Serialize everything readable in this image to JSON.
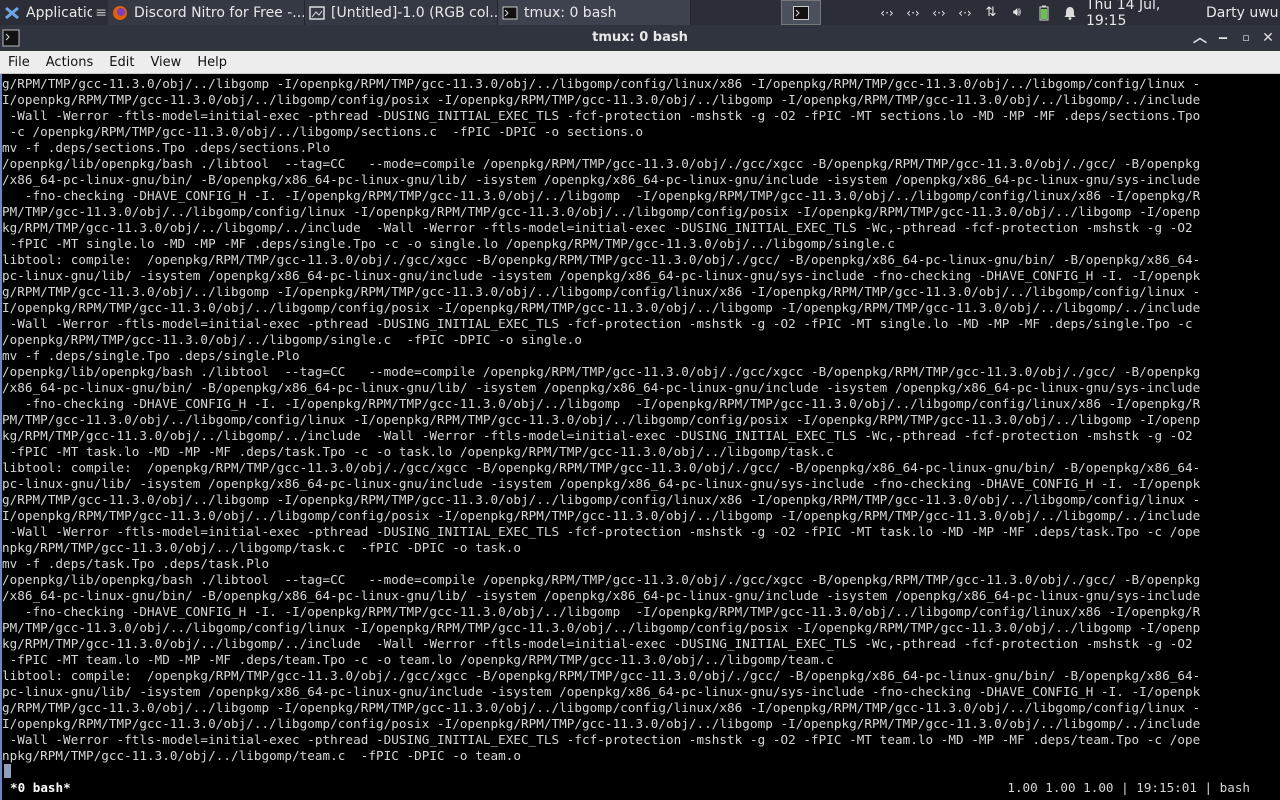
{
  "panel": {
    "apps_label": "Applications",
    "tasks": [
      {
        "label": "Discord Nitro for Free -..."
      },
      {
        "label": "[Untitled]-1.0 (RGB col..."
      },
      {
        "label": "tmux: 0 bash"
      }
    ],
    "clock": "Thu 14 Jul, 19:15",
    "user": "Darty uwu",
    "tray_icons": [
      "network-icon",
      "network-icon",
      "network-icon",
      "network-icon",
      "transfer-icon",
      "volume-icon",
      "battery-icon",
      "bell-icon"
    ]
  },
  "window": {
    "title": "tmux: 0 bash",
    "menu": [
      "File",
      "Actions",
      "Edit",
      "View",
      "Help"
    ]
  },
  "terminal": {
    "lines": [
      "g/RPM/TMP/gcc-11.3.0/obj/../libgomp -I/openpkg/RPM/TMP/gcc-11.3.0/obj/../libgomp/config/linux/x86 -I/openpkg/RPM/TMP/gcc-11.3.0/obj/../libgomp/config/linux -",
      "I/openpkg/RPM/TMP/gcc-11.3.0/obj/../libgomp/config/posix -I/openpkg/RPM/TMP/gcc-11.3.0/obj/../libgomp -I/openpkg/RPM/TMP/gcc-11.3.0/obj/../libgomp/../include",
      " -Wall -Werror -ftls-model=initial-exec -pthread -DUSING_INITIAL_EXEC_TLS -fcf-protection -mshstk -g -O2 -fPIC -MT sections.lo -MD -MP -MF .deps/sections.Tpo",
      " -c /openpkg/RPM/TMP/gcc-11.3.0/obj/../libgomp/sections.c  -fPIC -DPIC -o sections.o",
      "mv -f .deps/sections.Tpo .deps/sections.Plo",
      "/openpkg/lib/openpkg/bash ./libtool  --tag=CC   --mode=compile /openpkg/RPM/TMP/gcc-11.3.0/obj/./gcc/xgcc -B/openpkg/RPM/TMP/gcc-11.3.0/obj/./gcc/ -B/openpkg",
      "/x86_64-pc-linux-gnu/bin/ -B/openpkg/x86_64-pc-linux-gnu/lib/ -isystem /openpkg/x86_64-pc-linux-gnu/include -isystem /openpkg/x86_64-pc-linux-gnu/sys-include",
      "   -fno-checking -DHAVE_CONFIG_H -I. -I/openpkg/RPM/TMP/gcc-11.3.0/obj/../libgomp  -I/openpkg/RPM/TMP/gcc-11.3.0/obj/../libgomp/config/linux/x86 -I/openpkg/R",
      "PM/TMP/gcc-11.3.0/obj/../libgomp/config/linux -I/openpkg/RPM/TMP/gcc-11.3.0/obj/../libgomp/config/posix -I/openpkg/RPM/TMP/gcc-11.3.0/obj/../libgomp -I/openp",
      "kg/RPM/TMP/gcc-11.3.0/obj/../libgomp/../include  -Wall -Werror -ftls-model=initial-exec -DUSING_INITIAL_EXEC_TLS -Wc,-pthread -fcf-protection -mshstk -g -O2",
      " -fPIC -MT single.lo -MD -MP -MF .deps/single.Tpo -c -o single.lo /openpkg/RPM/TMP/gcc-11.3.0/obj/../libgomp/single.c",
      "libtool: compile:  /openpkg/RPM/TMP/gcc-11.3.0/obj/./gcc/xgcc -B/openpkg/RPM/TMP/gcc-11.3.0/obj/./gcc/ -B/openpkg/x86_64-pc-linux-gnu/bin/ -B/openpkg/x86_64-",
      "pc-linux-gnu/lib/ -isystem /openpkg/x86_64-pc-linux-gnu/include -isystem /openpkg/x86_64-pc-linux-gnu/sys-include -fno-checking -DHAVE_CONFIG_H -I. -I/openpk",
      "g/RPM/TMP/gcc-11.3.0/obj/../libgomp -I/openpkg/RPM/TMP/gcc-11.3.0/obj/../libgomp/config/linux/x86 -I/openpkg/RPM/TMP/gcc-11.3.0/obj/../libgomp/config/linux -",
      "I/openpkg/RPM/TMP/gcc-11.3.0/obj/../libgomp/config/posix -I/openpkg/RPM/TMP/gcc-11.3.0/obj/../libgomp -I/openpkg/RPM/TMP/gcc-11.3.0/obj/../libgomp/../include",
      " -Wall -Werror -ftls-model=initial-exec -pthread -DUSING_INITIAL_EXEC_TLS -fcf-protection -mshstk -g -O2 -fPIC -MT single.lo -MD -MP -MF .deps/single.Tpo -c",
      "/openpkg/RPM/TMP/gcc-11.3.0/obj/../libgomp/single.c  -fPIC -DPIC -o single.o",
      "mv -f .deps/single.Tpo .deps/single.Plo",
      "/openpkg/lib/openpkg/bash ./libtool  --tag=CC   --mode=compile /openpkg/RPM/TMP/gcc-11.3.0/obj/./gcc/xgcc -B/openpkg/RPM/TMP/gcc-11.3.0/obj/./gcc/ -B/openpkg",
      "/x86_64-pc-linux-gnu/bin/ -B/openpkg/x86_64-pc-linux-gnu/lib/ -isystem /openpkg/x86_64-pc-linux-gnu/include -isystem /openpkg/x86_64-pc-linux-gnu/sys-include",
      "   -fno-checking -DHAVE_CONFIG_H -I. -I/openpkg/RPM/TMP/gcc-11.3.0/obj/../libgomp  -I/openpkg/RPM/TMP/gcc-11.3.0/obj/../libgomp/config/linux/x86 -I/openpkg/R",
      "PM/TMP/gcc-11.3.0/obj/../libgomp/config/linux -I/openpkg/RPM/TMP/gcc-11.3.0/obj/../libgomp/config/posix -I/openpkg/RPM/TMP/gcc-11.3.0/obj/../libgomp -I/openp",
      "kg/RPM/TMP/gcc-11.3.0/obj/../libgomp/../include  -Wall -Werror -ftls-model=initial-exec -DUSING_INITIAL_EXEC_TLS -Wc,-pthread -fcf-protection -mshstk -g -O2",
      " -fPIC -MT task.lo -MD -MP -MF .deps/task.Tpo -c -o task.lo /openpkg/RPM/TMP/gcc-11.3.0/obj/../libgomp/task.c",
      "libtool: compile:  /openpkg/RPM/TMP/gcc-11.3.0/obj/./gcc/xgcc -B/openpkg/RPM/TMP/gcc-11.3.0/obj/./gcc/ -B/openpkg/x86_64-pc-linux-gnu/bin/ -B/openpkg/x86_64-",
      "pc-linux-gnu/lib/ -isystem /openpkg/x86_64-pc-linux-gnu/include -isystem /openpkg/x86_64-pc-linux-gnu/sys-include -fno-checking -DHAVE_CONFIG_H -I. -I/openpk",
      "g/RPM/TMP/gcc-11.3.0/obj/../libgomp -I/openpkg/RPM/TMP/gcc-11.3.0/obj/../libgomp/config/linux/x86 -I/openpkg/RPM/TMP/gcc-11.3.0/obj/../libgomp/config/linux -",
      "I/openpkg/RPM/TMP/gcc-11.3.0/obj/../libgomp/config/posix -I/openpkg/RPM/TMP/gcc-11.3.0/obj/../libgomp -I/openpkg/RPM/TMP/gcc-11.3.0/obj/../libgomp/../include",
      " -Wall -Werror -ftls-model=initial-exec -pthread -DUSING_INITIAL_EXEC_TLS -fcf-protection -mshstk -g -O2 -fPIC -MT task.lo -MD -MP -MF .deps/task.Tpo -c /ope",
      "npkg/RPM/TMP/gcc-11.3.0/obj/../libgomp/task.c  -fPIC -DPIC -o task.o",
      "mv -f .deps/task.Tpo .deps/task.Plo",
      "/openpkg/lib/openpkg/bash ./libtool  --tag=CC   --mode=compile /openpkg/RPM/TMP/gcc-11.3.0/obj/./gcc/xgcc -B/openpkg/RPM/TMP/gcc-11.3.0/obj/./gcc/ -B/openpkg",
      "/x86_64-pc-linux-gnu/bin/ -B/openpkg/x86_64-pc-linux-gnu/lib/ -isystem /openpkg/x86_64-pc-linux-gnu/include -isystem /openpkg/x86_64-pc-linux-gnu/sys-include",
      "   -fno-checking -DHAVE_CONFIG_H -I. -I/openpkg/RPM/TMP/gcc-11.3.0/obj/../libgomp  -I/openpkg/RPM/TMP/gcc-11.3.0/obj/../libgomp/config/linux/x86 -I/openpkg/R",
      "PM/TMP/gcc-11.3.0/obj/../libgomp/config/linux -I/openpkg/RPM/TMP/gcc-11.3.0/obj/../libgomp/config/posix -I/openpkg/RPM/TMP/gcc-11.3.0/obj/../libgomp -I/openp",
      "kg/RPM/TMP/gcc-11.3.0/obj/../libgomp/../include  -Wall -Werror -ftls-model=initial-exec -DUSING_INITIAL_EXEC_TLS -Wc,-pthread -fcf-protection -mshstk -g -O2",
      " -fPIC -MT team.lo -MD -MP -MF .deps/team.Tpo -c -o team.lo /openpkg/RPM/TMP/gcc-11.3.0/obj/../libgomp/team.c",
      "libtool: compile:  /openpkg/RPM/TMP/gcc-11.3.0/obj/./gcc/xgcc -B/openpkg/RPM/TMP/gcc-11.3.0/obj/./gcc/ -B/openpkg/x86_64-pc-linux-gnu/bin/ -B/openpkg/x86_64-",
      "pc-linux-gnu/lib/ -isystem /openpkg/x86_64-pc-linux-gnu/include -isystem /openpkg/x86_64-pc-linux-gnu/sys-include -fno-checking -DHAVE_CONFIG_H -I. -I/openpk",
      "g/RPM/TMP/gcc-11.3.0/obj/../libgomp -I/openpkg/RPM/TMP/gcc-11.3.0/obj/../libgomp/config/linux/x86 -I/openpkg/RPM/TMP/gcc-11.3.0/obj/../libgomp/config/linux -",
      "I/openpkg/RPM/TMP/gcc-11.3.0/obj/../libgomp/config/posix -I/openpkg/RPM/TMP/gcc-11.3.0/obj/../libgomp -I/openpkg/RPM/TMP/gcc-11.3.0/obj/../libgomp/../include",
      " -Wall -Werror -ftls-model=initial-exec -pthread -DUSING_INITIAL_EXEC_TLS -fcf-protection -mshstk -g -O2 -fPIC -MT team.lo -MD -MP -MF .deps/team.Tpo -c /ope",
      "npkg/RPM/TMP/gcc-11.3.0/obj/../libgomp/team.c  -fPIC -DPIC -o team.o"
    ],
    "status_left": "*0 bash*",
    "status_right": "1.00 1.00 1.00 | 19:15:01 | bash"
  },
  "colors": {
    "accent": "#6a89c4",
    "panel_bg": "#2b2e37",
    "terminal_bg": "#000000"
  }
}
